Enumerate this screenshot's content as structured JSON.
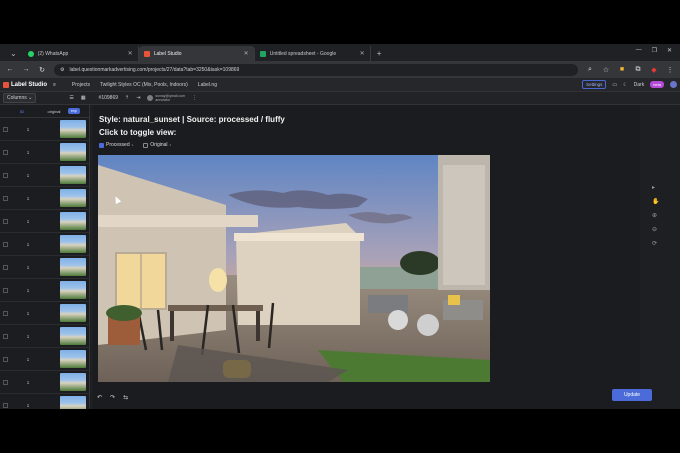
{
  "browser": {
    "tabs": [
      {
        "title": "(2) WhatsApp",
        "color": "#25d366"
      },
      {
        "title": "Label Studio",
        "color": "#e8533a"
      },
      {
        "title": "Untitled spreadsheet - Google",
        "color": "#1fa463"
      }
    ],
    "new_tab": "+",
    "url": "label.questionmarkadvertising.com/projects/27/data?tab=3250&task=109869"
  },
  "app": {
    "name": "Label Studio",
    "breadcrumbs": [
      "Projects",
      "Twilight Styles OC (Mix, Pools, Indoors)",
      "Label.ng"
    ],
    "settings_label": "Settings",
    "theme_label": "Dark",
    "beta_label": "beta"
  },
  "toolbar": {
    "columns_label": "Columns",
    "task_id": "#109869",
    "user_line1": "ssmay@qmail.com",
    "user_line2": "annotator"
  },
  "table": {
    "headers": [
      "ID",
      "original",
      "exp"
    ],
    "rows": [
      {
        "id": "1"
      },
      {
        "id": "1"
      },
      {
        "id": "1"
      },
      {
        "id": "1"
      },
      {
        "id": "1"
      },
      {
        "id": "1"
      },
      {
        "id": "1"
      },
      {
        "id": "1"
      },
      {
        "id": "1"
      },
      {
        "id": "1"
      },
      {
        "id": "1"
      },
      {
        "id": "1"
      },
      {
        "id": "1"
      }
    ]
  },
  "main": {
    "style_text": "Style: natural_sunset | Source: processed / fluffy",
    "toggle_text": "Click to toggle view:",
    "choices": [
      {
        "label": "Processed",
        "hotkey": "1",
        "checked": true
      },
      {
        "label": "Original",
        "hotkey": "2",
        "checked": false
      }
    ],
    "update_label": "Update"
  },
  "colors": {
    "accent": "#4a6bd8",
    "brand": "#e8533a"
  }
}
